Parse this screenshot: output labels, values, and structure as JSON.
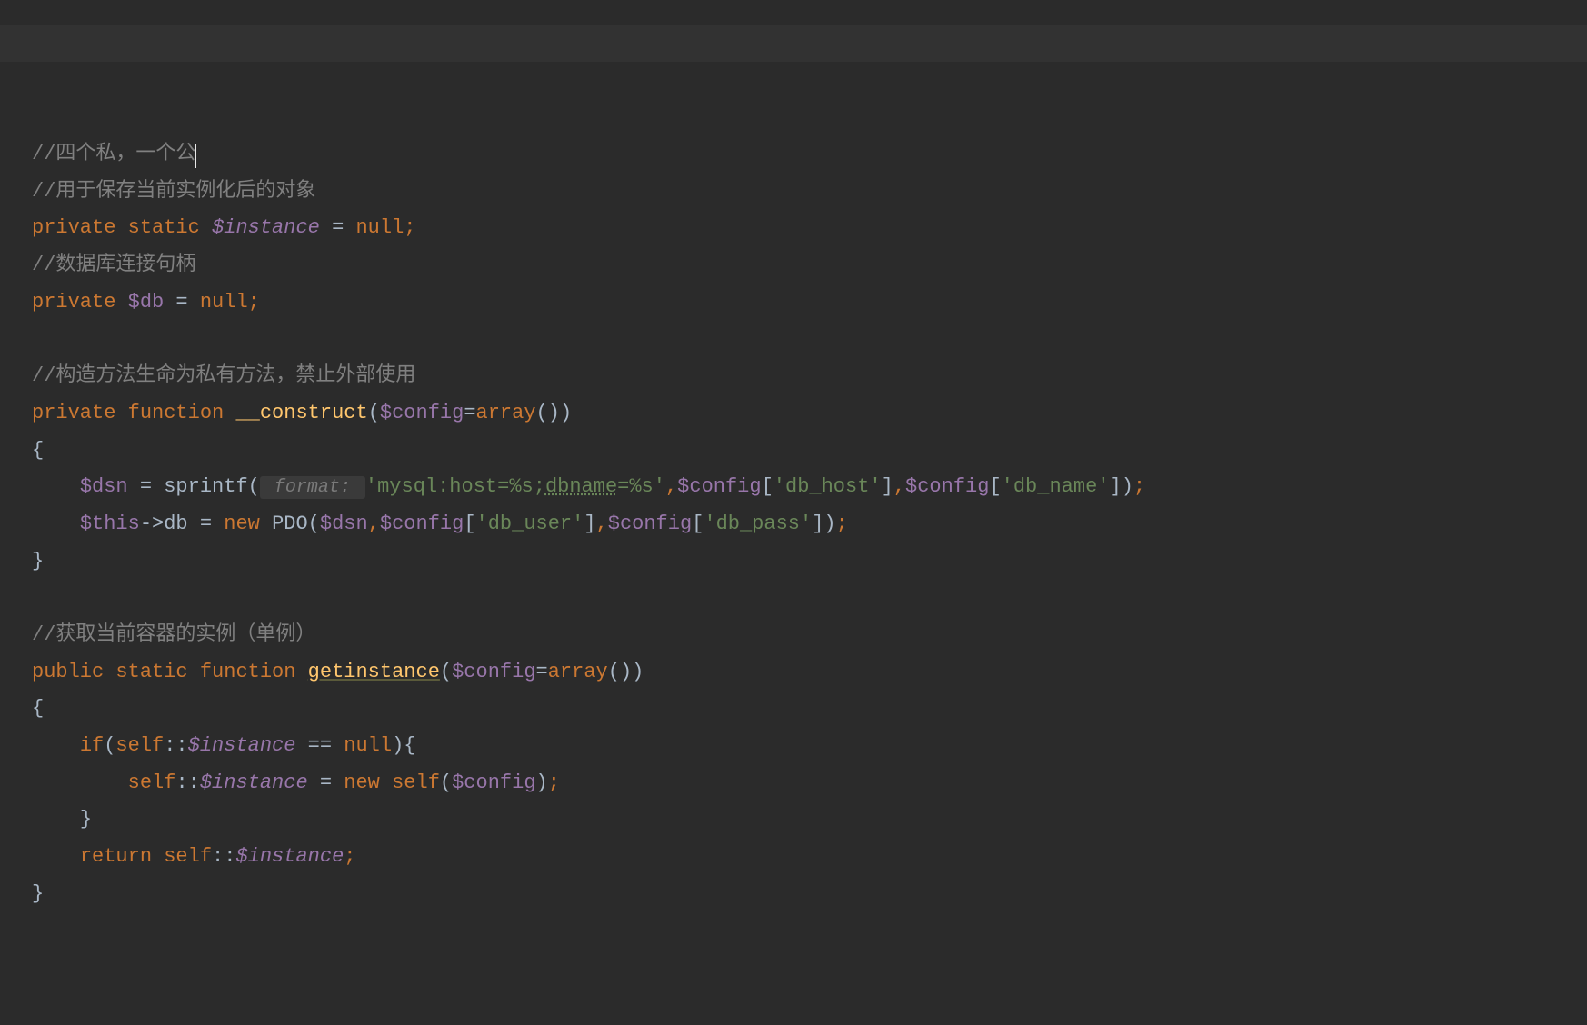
{
  "code": {
    "line1_comment": "//四个私，一个公",
    "line2_comment": "//用于保存当前实例化后的对象",
    "line3": {
      "kw_private": "private",
      "kw_static": "static",
      "var": "$instance",
      "eq": " = ",
      "null": "null",
      "semi": ";"
    },
    "line4_comment": "//数据库连接句柄",
    "line5": {
      "kw_private": "private",
      "var": "$db",
      "eq": " = ",
      "null": "null",
      "semi": ";"
    },
    "line7_comment": "//构造方法生命为私有方法，禁止外部使用",
    "line8": {
      "kw_private": "private",
      "kw_function": "function",
      "name": "__construct",
      "lparen": "(",
      "param": "$config",
      "eq": "=",
      "kw_array": "array",
      "parens": "()",
      "rparen": ")"
    },
    "line9_brace": "{",
    "line10": {
      "var_dsn": "$dsn",
      "eq": " = ",
      "sprintf": "sprintf",
      "lparen": "(",
      "hint": " format: ",
      "str1": "'mysql:host=%s;",
      "str1b": "dbname",
      "str1c": "=%s'",
      "comma1": ",",
      "cfg1": "$config",
      "bracket1_open": "[",
      "key1": "'db_host'",
      "bracket1_close": "]",
      "comma2": ",",
      "cfg2": "$config",
      "bracket2_open": "[",
      "key2": "'db_name'",
      "bracket2_close": "]",
      "rparen": ")",
      "semi": ";"
    },
    "line11": {
      "this": "$this",
      "arrow": "->",
      "db": "db",
      "eq": " = ",
      "kw_new": "new",
      "pdo": "PDO",
      "lparen": "(",
      "dsn": "$dsn",
      "comma1": ",",
      "cfg1": "$config",
      "b1o": "[",
      "key1": "'db_user'",
      "b1c": "]",
      "comma2": ",",
      "cfg2": "$config",
      "b2o": "[",
      "key2": "'db_pass'",
      "b2c": "]",
      "rparen": ")",
      "semi": ";"
    },
    "line12_brace": "}",
    "line14_comment": "//获取当前容器的实例（单例）",
    "line15": {
      "kw_public": "public",
      "kw_static": "static",
      "kw_function": "function",
      "name": "getinstance",
      "lparen": "(",
      "param": "$config",
      "eq": "=",
      "kw_array": "array",
      "parens": "()",
      "rparen": ")"
    },
    "line16_brace": "{",
    "line17": {
      "kw_if": "if",
      "lparen": "(",
      "self": "self",
      "dcolon": "::",
      "var": "$instance",
      "eqeq": " == ",
      "null": "null",
      "rparen": ")",
      "lbrace": "{"
    },
    "line18": {
      "self1": "self",
      "dcolon1": "::",
      "var": "$instance",
      "eq": " = ",
      "kw_new": "new",
      "self2": "self",
      "lparen": "(",
      "cfg": "$config",
      "rparen": ")",
      "semi": ";"
    },
    "line19_brace": "}",
    "line20": {
      "kw_return": "return",
      "self": "self",
      "dcolon": "::",
      "var": "$instance",
      "semi": ";"
    },
    "line21_brace": "}"
  }
}
